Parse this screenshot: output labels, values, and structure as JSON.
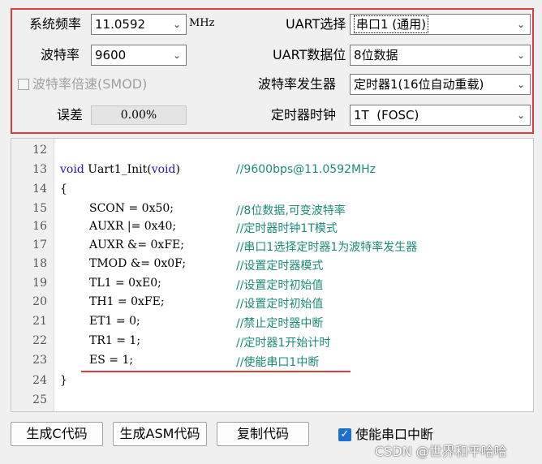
{
  "settings": {
    "sysfreq_label": "系统频率",
    "sysfreq_value": "11.0592",
    "sysfreq_unit": "MHz",
    "baud_label": "波特率",
    "baud_value": "9600",
    "smod_label": "波特率倍速(SMOD)",
    "error_label": "误差",
    "error_value": "0.00%",
    "uart_label": "UART选择",
    "uart_value": "串口1 (通用)",
    "databits_label": "UART数据位",
    "databits_value": "8位数据",
    "baudgen_label": "波特率发生器",
    "baudgen_value": "定时器1(16位自动重载)",
    "timerclk_label": "定时器时钟",
    "timerclk_value": "1T  (FOSC)"
  },
  "editor": {
    "lines": [
      {
        "n": "12",
        "code": "",
        "comment": ""
      },
      {
        "n": "13",
        "code": "Uart1_Init(",
        "kw1": "void",
        "kw2": "void",
        "tail": ")",
        "comment": "//9600bps@11.0592MHz"
      },
      {
        "n": "14",
        "code": "{",
        "comment": ""
      },
      {
        "n": "15",
        "code": "SCON = 0x50;",
        "comment": "//8位数据,可变波特率"
      },
      {
        "n": "16",
        "code": "AUXR |= 0x40;",
        "comment": "//定时器时钟1T模式"
      },
      {
        "n": "17",
        "code": "AUXR &= 0xFE;",
        "comment": "//串口1选择定时器1为波特率发生器"
      },
      {
        "n": "18",
        "code": "TMOD &= 0x0F;",
        "comment": "//设置定时器模式"
      },
      {
        "n": "19",
        "code": "TL1 = 0xE0;",
        "comment": "//设置定时初始值"
      },
      {
        "n": "20",
        "code": "TH1 = 0xFE;",
        "comment": "//设置定时初始值"
      },
      {
        "n": "21",
        "code": "ET1 = 0;",
        "comment": "//禁止定时器中断"
      },
      {
        "n": "22",
        "code": "TR1 = 1;",
        "comment": "//定时器1开始计时"
      },
      {
        "n": "23",
        "code": "ES = 1;",
        "comment": "//使能串口1中断"
      },
      {
        "n": "24",
        "code": "}",
        "comment": ""
      },
      {
        "n": "25",
        "code": "",
        "comment": ""
      }
    ]
  },
  "buttons": {
    "gen_c": "生成C代码",
    "gen_asm": "生成ASM代码",
    "copy": "复制代码",
    "enable_int": "使能串口中断"
  },
  "watermark": "CSDN @世界和平哈哈",
  "colors": {
    "highlight_border": "#e03c3c",
    "comment": "#1a8a7a",
    "keyword": "#1c1ca8",
    "checkbox": "#1e6fd0"
  }
}
